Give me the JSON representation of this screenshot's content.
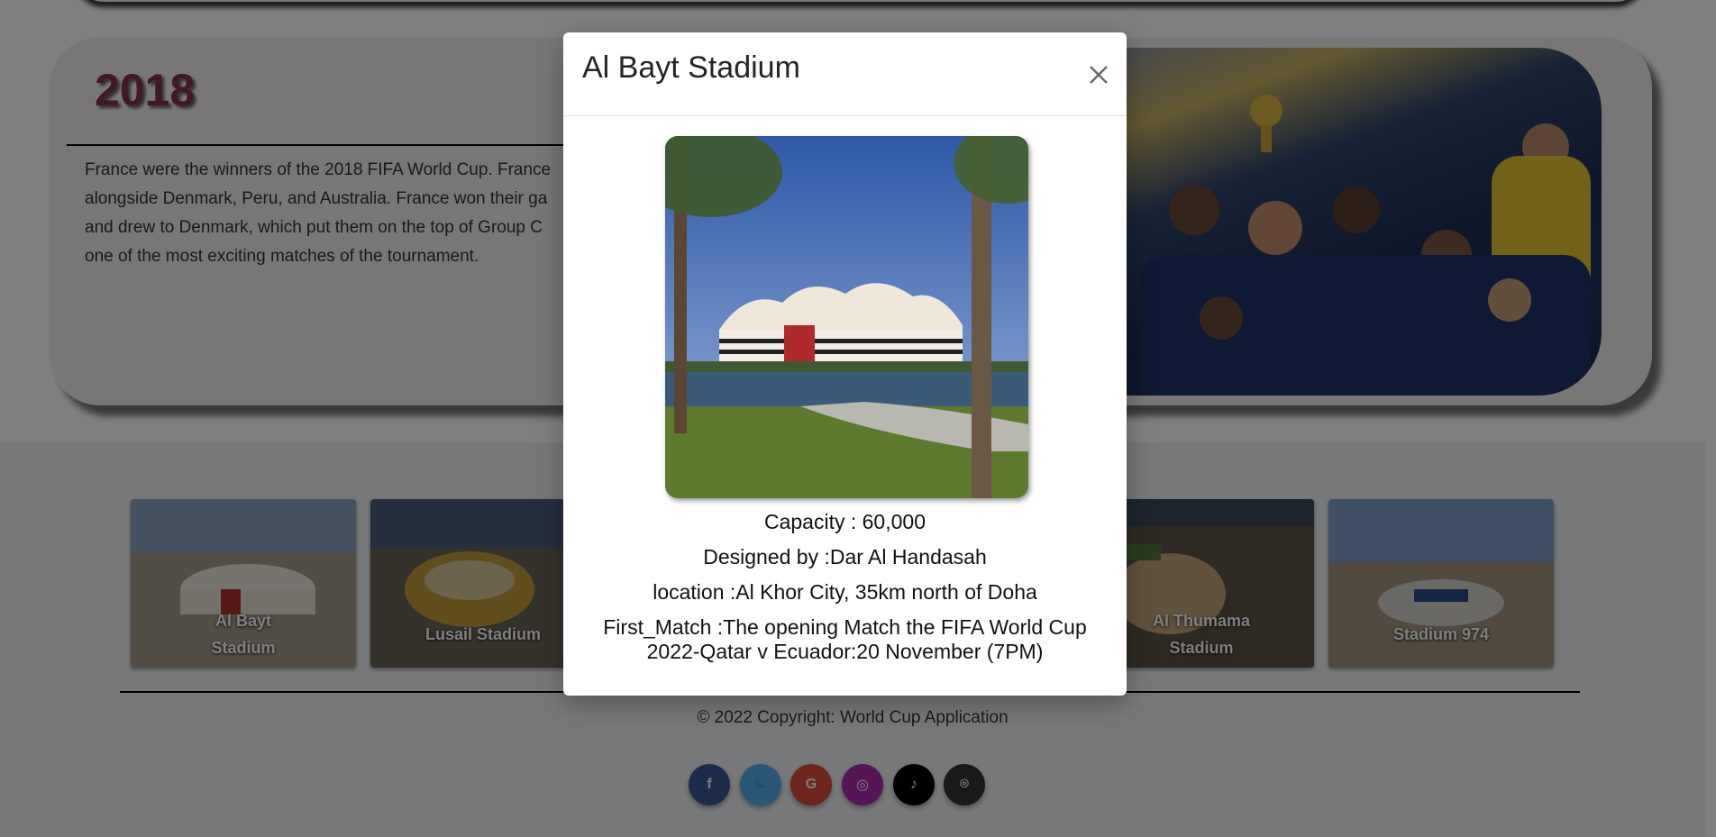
{
  "year_section": {
    "year": "2018",
    "text_lines": [
      "France were the winners of the 2018 FIFA World Cup. France",
      "alongside Denmark, Peru, and Australia. France won their ga",
      "and drew to Denmark, which put them on the top of Group C",
      "one of the most exciting matches of the tournament."
    ]
  },
  "stadiums": [
    {
      "name_line1": "Al Bayt",
      "name_line2": "Stadium"
    },
    {
      "name_line1": "Lusail Stadium",
      "name_line2": ""
    },
    {
      "name_line1": "Al Thumama",
      "name_line2": "Stadium"
    },
    {
      "name_line1": "Stadium 974",
      "name_line2": ""
    }
  ],
  "footer": {
    "copyright_prefix": "© 2022 Copyright:",
    "copyright_link": "World Cup Application"
  },
  "social_icons": [
    {
      "name": "facebook-icon",
      "glyph": "f",
      "color": "#3b5998"
    },
    {
      "name": "twitter-icon",
      "glyph": "🐦",
      "color": "#55acee"
    },
    {
      "name": "google-icon",
      "glyph": "G",
      "color": "#dd4b39"
    },
    {
      "name": "instagram-icon",
      "glyph": "◎",
      "color": "#ac2bac"
    },
    {
      "name": "tiktok-icon",
      "glyph": "♪",
      "color": "#000000"
    },
    {
      "name": "github-icon",
      "glyph": "⌾",
      "color": "#333333"
    }
  ],
  "modal": {
    "title": "Al Bayt Stadium",
    "capacity": "Capacity : 60,000",
    "designed_by": "Designed by :Dar Al Handasah",
    "location": "location :Al Khor City, 35km north of Doha",
    "first_match_line1": "First_Match :The opening Match the FIFA World Cup",
    "first_match_line2": "2022-Qatar v Ecuador:20 November (7PM)"
  }
}
